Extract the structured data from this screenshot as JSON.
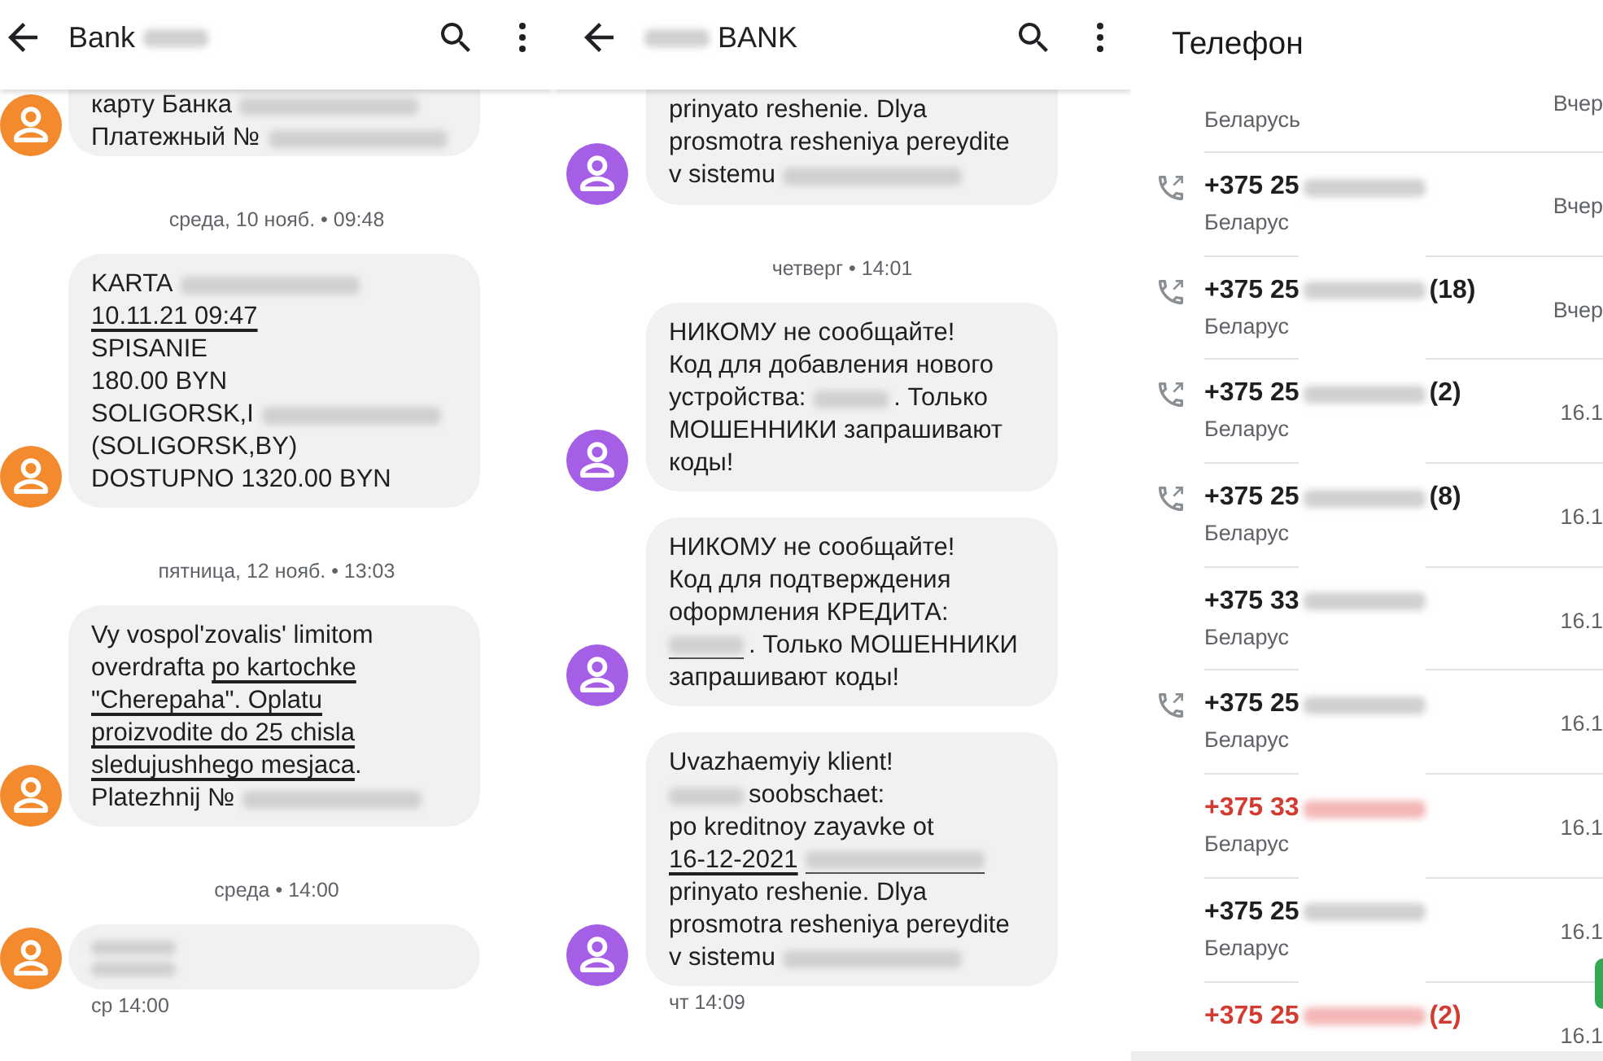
{
  "threads": [
    {
      "color": "#f38a2d",
      "title": [
        {
          "kind": "text",
          "text": "Bank"
        },
        {
          "kind": "blur"
        }
      ],
      "items": [
        {
          "kind": "message",
          "cut_top": true,
          "lines": [
            [
              {
                "kind": "text",
                "text": "карту Банка",
                "underlined": false
              },
              {
                "kind": "blur",
                "underlined": false
              }
            ],
            [
              {
                "kind": "text",
                "text": "Платежный №",
                "underlined": false
              },
              {
                "kind": "blur",
                "underlined": false
              }
            ]
          ]
        },
        {
          "kind": "date",
          "text": "среда, 10 нояб. • 09:48"
        },
        {
          "kind": "message",
          "cut_top": false,
          "lines": [
            [
              {
                "kind": "text",
                "text": "KARTA",
                "underlined": false
              },
              {
                "kind": "blur",
                "underlined": false
              }
            ],
            [
              {
                "kind": "text",
                "text": "10.11.21 09:47",
                "underlined": true
              }
            ],
            [
              {
                "kind": "text",
                "text": "SPISANIE",
                "underlined": false
              }
            ],
            [
              {
                "kind": "text",
                "text": "180.00 BYN",
                "underlined": false
              }
            ],
            [
              {
                "kind": "text",
                "text": "SOLIGORSK,I",
                "underlined": false
              },
              {
                "kind": "blur",
                "underlined": false
              }
            ],
            [
              {
                "kind": "text",
                "text": "(SOLIGORSK,BY)",
                "underlined": false
              }
            ],
            [
              {
                "kind": "text",
                "text": "DOSTUPNO 1320.00 BYN",
                "underlined": false
              }
            ]
          ]
        },
        {
          "kind": "date",
          "text": "пятница, 12 нояб. • 13:03"
        },
        {
          "kind": "message",
          "cut_top": false,
          "lines": [
            [
              {
                "kind": "text",
                "text": "Vy vospol'zovalis' limitom",
                "underlined": false
              }
            ],
            [
              {
                "kind": "text",
                "text": "overdrafta ",
                "underlined": false
              },
              {
                "kind": "text",
                "text": "po kartochke",
                "underlined": true
              }
            ],
            [
              {
                "kind": "text",
                "text": "\"Cherepaha\". Oplatu",
                "underlined": true
              }
            ],
            [
              {
                "kind": "text",
                "text": "proizvodite do 25 chisla",
                "underlined": true
              }
            ],
            [
              {
                "kind": "text",
                "text": "sledujushhego mesjaca",
                "underlined": true
              },
              {
                "kind": "text",
                "text": ".",
                "underlined": false
              }
            ],
            [
              {
                "kind": "text",
                "text": "Platezhnij №",
                "underlined": false
              },
              {
                "kind": "blur",
                "underlined": false
              }
            ]
          ]
        },
        {
          "kind": "date",
          "text": "среда • 14:00"
        },
        {
          "kind": "message",
          "cut_top": false,
          "lines": [
            [
              {
                "kind": "blur",
                "underlined": false
              }
            ],
            [
              {
                "kind": "blur",
                "underlined": false
              }
            ]
          ]
        },
        {
          "kind": "time",
          "text": "ср 14:00"
        }
      ]
    },
    {
      "color": "#a55fe6",
      "title": [
        {
          "kind": "blur"
        },
        {
          "kind": "text",
          "text": "BANK"
        }
      ],
      "items": [
        {
          "kind": "message",
          "cut_top": true,
          "lines": [
            [
              {
                "kind": "text",
                "text": "prinyato reshenie. Dlya",
                "underlined": false
              }
            ],
            [
              {
                "kind": "text",
                "text": "prosmotra resheniya pereydite",
                "underlined": false
              }
            ],
            [
              {
                "kind": "text",
                "text": "v sistemu",
                "underlined": false
              },
              {
                "kind": "blur",
                "underlined": false
              }
            ]
          ]
        },
        {
          "kind": "date",
          "text": "четверг • 14:01"
        },
        {
          "kind": "message",
          "cut_top": false,
          "lines": [
            [
              {
                "kind": "text",
                "text": "НИКОМУ не сообщайте!",
                "underlined": false
              }
            ],
            [
              {
                "kind": "text",
                "text": "Код для добавления нового",
                "underlined": false
              }
            ],
            [
              {
                "kind": "text",
                "text": "устройства:",
                "underlined": false
              },
              {
                "kind": "blur",
                "underlined": false
              },
              {
                "kind": "text",
                "text": ". Только",
                "underlined": false
              }
            ],
            [
              {
                "kind": "text",
                "text": "МОШЕННИКИ запрашивают",
                "underlined": false
              }
            ],
            [
              {
                "kind": "text",
                "text": "коды!",
                "underlined": false
              }
            ]
          ]
        },
        {
          "kind": "message",
          "cut_top": false,
          "lines": [
            [
              {
                "kind": "text",
                "text": "НИКОМУ не сообщайте!",
                "underlined": false
              }
            ],
            [
              {
                "kind": "text",
                "text": "Код для подтверждения",
                "underlined": false
              }
            ],
            [
              {
                "kind": "text",
                "text": "оформления КРЕДИТА:",
                "underlined": false
              }
            ],
            [
              {
                "kind": "blur",
                "underlined": true
              },
              {
                "kind": "text",
                "text": ". Только МОШЕННИКИ",
                "underlined": false
              }
            ],
            [
              {
                "kind": "text",
                "text": "запрашивают коды!",
                "underlined": false
              }
            ]
          ]
        },
        {
          "kind": "message",
          "cut_top": false,
          "lines": [
            [
              {
                "kind": "text",
                "text": "Uvazhaemyiy klient!",
                "underlined": false
              }
            ],
            [
              {
                "kind": "blur",
                "underlined": false
              },
              {
                "kind": "text",
                "text": "soobschaet:",
                "underlined": false
              }
            ],
            [
              {
                "kind": "text",
                "text": "po kreditnoy zayavke ot",
                "underlined": false
              }
            ],
            [
              {
                "kind": "text",
                "text": "16-12-2021",
                "underlined": true
              },
              {
                "kind": "blur",
                "underlined": true
              }
            ],
            [
              {
                "kind": "text",
                "text": "prinyato reshenie. Dlya",
                "underlined": false
              }
            ],
            [
              {
                "kind": "text",
                "text": "prosmotra resheniya pereydite",
                "underlined": false
              }
            ],
            [
              {
                "kind": "text",
                "text": "v sistemu",
                "underlined": false
              },
              {
                "kind": "blur",
                "underlined": false
              }
            ]
          ]
        },
        {
          "kind": "time",
          "text": "чт 14:09"
        }
      ]
    }
  ],
  "call_log": {
    "title": "Телефон",
    "calls": [
      {
        "kind": "cut",
        "region": "Беларусь",
        "date": "Вчер"
      },
      {
        "kind": "call",
        "number": "+375 25",
        "region": "Беларус",
        "date": "Вчер",
        "outgoing": true,
        "missed": false
      },
      {
        "kind": "call",
        "number": "+375 25",
        "count": "(18)",
        "region": "Беларус",
        "date": "Вчер",
        "outgoing": true,
        "missed": false
      },
      {
        "kind": "call",
        "number": "+375 25",
        "count": "(2)",
        "region": "Беларус",
        "date": "16.1",
        "outgoing": true,
        "missed": false
      },
      {
        "kind": "call",
        "number": "+375 25",
        "count": "(8)",
        "region": "Беларус",
        "date": "16.1",
        "outgoing": true,
        "missed": false
      },
      {
        "kind": "call",
        "number": "+375 33",
        "region": "Беларус",
        "date": "16.1",
        "outgoing": false,
        "missed": false
      },
      {
        "kind": "call",
        "number": "+375 25",
        "region": "Беларус",
        "date": "16.1",
        "outgoing": true,
        "missed": false
      },
      {
        "kind": "call",
        "number": "+375 33",
        "region": "Беларус",
        "date": "16.1",
        "outgoing": false,
        "missed": true
      },
      {
        "kind": "call",
        "number": "+375 25",
        "region": "Беларус",
        "date": "16.1",
        "outgoing": false,
        "missed": false
      },
      {
        "kind": "call",
        "number": "+375 25",
        "count": "(2)",
        "date": "16.1",
        "outgoing": false,
        "missed": true
      }
    ]
  }
}
